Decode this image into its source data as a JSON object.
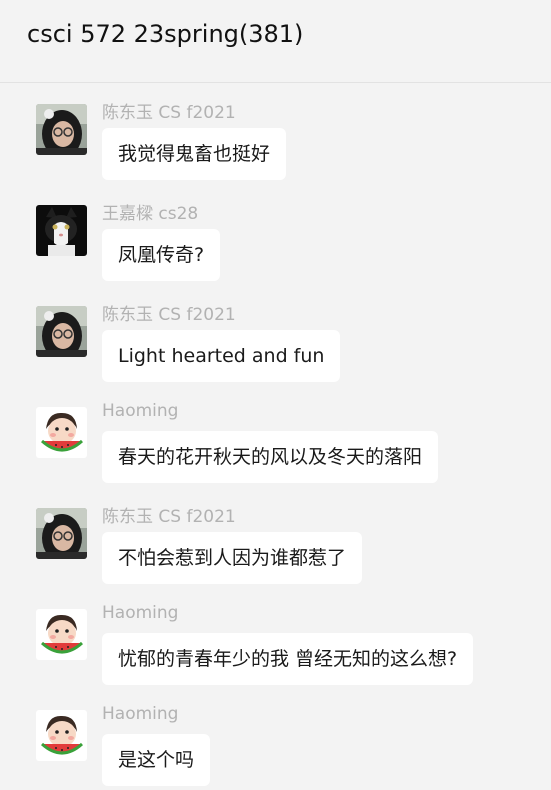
{
  "window": {
    "title": "csci 572 23spring(381)"
  },
  "messages": [
    {
      "sender": "陈东玉 CS f2021",
      "avatar": "woman-glasses-avatar",
      "text": "我觉得鬼畜也挺好"
    },
    {
      "sender": "王嘉樑 cs28",
      "avatar": "cat-avatar",
      "text": "凤凰传奇?"
    },
    {
      "sender": "陈东玉 CS f2021",
      "avatar": "woman-glasses-avatar",
      "text": "Light hearted and fun"
    },
    {
      "sender": "Haoming",
      "avatar": "cartoon-kid-watermelon-avatar",
      "text": "春天的花开秋天的风以及冬天的落阳"
    },
    {
      "sender": "陈东玉 CS f2021",
      "avatar": "woman-glasses-avatar",
      "text": "不怕会惹到人因为谁都惹了"
    },
    {
      "sender": "Haoming",
      "avatar": "cartoon-kid-watermelon-avatar",
      "text": "忧郁的青春年少的我 曾经无知的这么想?"
    },
    {
      "sender": "Haoming",
      "avatar": "cartoon-kid-watermelon-avatar",
      "text": "是这个吗"
    }
  ],
  "colors": {
    "background": "#f3f3f3",
    "bubble": "#ffffff",
    "sender_name": "#b2b2b2",
    "message_text": "#1a1a1a"
  }
}
